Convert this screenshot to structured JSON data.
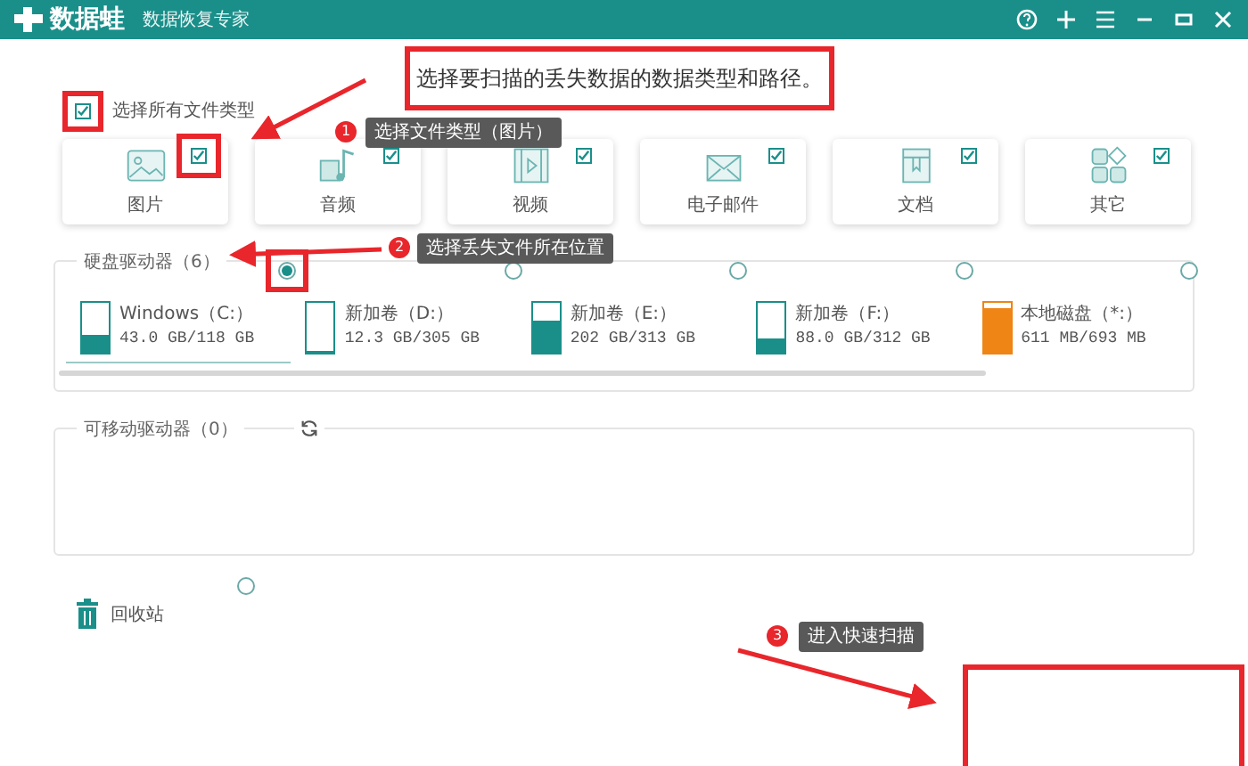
{
  "app": {
    "name": "数据蛙",
    "subtitle": "数据恢复专家"
  },
  "headline": "选择要扫描的丢失数据的数据类型和路径。",
  "select_all": {
    "label": "选择所有文件类型",
    "checked": true
  },
  "file_types": [
    {
      "kind": "image",
      "label": "图片",
      "checked": true
    },
    {
      "kind": "audio",
      "label": "音频",
      "checked": true
    },
    {
      "kind": "video",
      "label": "视频",
      "checked": true
    },
    {
      "kind": "email",
      "label": "电子邮件",
      "checked": true
    },
    {
      "kind": "document",
      "label": "文档",
      "checked": true
    },
    {
      "kind": "other",
      "label": "其它",
      "checked": true
    }
  ],
  "hard_drives": {
    "title": "硬盘驱动器（6）",
    "drives": [
      {
        "name": "Windows（C:）",
        "usage": "43.0 GB/118 GB",
        "level": 0.36,
        "selected": true,
        "color": "#1a8f8a"
      },
      {
        "name": "新加卷（D:）",
        "usage": "12.3 GB/305 GB",
        "level": 0.04,
        "selected": false,
        "color": "#1a8f8a"
      },
      {
        "name": "新加卷（E:）",
        "usage": "202 GB/313 GB",
        "level": 0.65,
        "selected": false,
        "color": "#1a8f8a"
      },
      {
        "name": "新加卷（F:）",
        "usage": "88.0 GB/312 GB",
        "level": 0.28,
        "selected": false,
        "color": "#1a8f8a"
      },
      {
        "name": "本地磁盘（*:）",
        "usage": "611 MB/693 MB",
        "level": 0.88,
        "selected": false,
        "color": "#ee8514"
      }
    ]
  },
  "removable_drives": {
    "title": "可移动驱动器（0）"
  },
  "recycle_bin": {
    "label": "回收站",
    "selected": false
  },
  "annotations": [
    {
      "number": "1",
      "text": "选择文件类型（图片）"
    },
    {
      "number": "2",
      "text": "选择丢失文件所在位置"
    },
    {
      "number": "3",
      "text": "进入快速扫描"
    }
  ]
}
